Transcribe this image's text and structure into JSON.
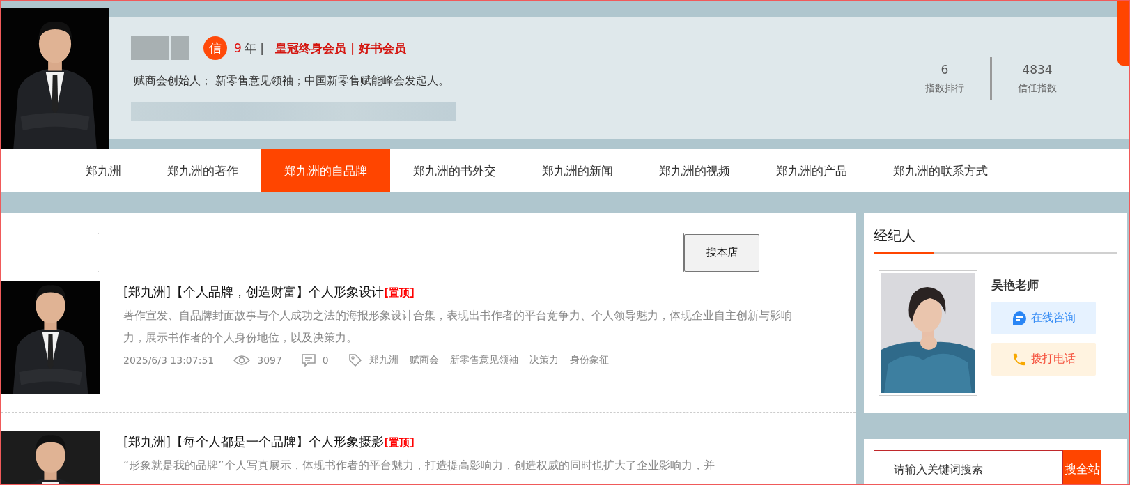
{
  "profile": {
    "badge": "信",
    "years": "9",
    "years_unit": "年 |",
    "membership": "皇冠终身会员 | 好书会员",
    "bio": "赋商会创始人； 新零售意见领袖；中国新零售赋能峰会发起人。",
    "stats": [
      {
        "value": "6",
        "label": "指数排行"
      },
      {
        "value": "4834",
        "label": "信任指数"
      }
    ]
  },
  "nav": [
    {
      "label": "郑九洲",
      "selected": false
    },
    {
      "label": "郑九洲的著作",
      "selected": false
    },
    {
      "label": "郑九洲的自品牌",
      "selected": true
    },
    {
      "label": "郑九洲的书外交",
      "selected": false
    },
    {
      "label": "郑九洲的新闻",
      "selected": false
    },
    {
      "label": "郑九洲的视频",
      "selected": false
    },
    {
      "label": "郑九洲的产品",
      "selected": false
    },
    {
      "label": "郑九洲的联系方式",
      "selected": false
    }
  ],
  "store_search": {
    "button": "搜本店"
  },
  "articles": [
    {
      "title": "[郑九洲]【个人品牌，创造财富】个人形象设计",
      "pin": "[置顶]",
      "description": "著作宣发、自品牌封面故事与个人成功之法的海报形象设计合集，表现出书作者的平台竞争力、个人领导魅力，体现企业自主创新与影响力，展示书作者的个人身份地位，以及决策力。",
      "date": "2025/6/3 13:07:51",
      "views": "3097",
      "comments": "0",
      "tags": [
        "郑九洲",
        "赋商会",
        "新零售意见领袖",
        "决策力",
        "身份象征"
      ]
    },
    {
      "title": "[郑九洲]【每个人都是一个品牌】个人形象摄影",
      "pin": "[置顶]",
      "description": "“形象就是我的品牌”个人写真展示，体现书作者的平台魅力，打造提高影响力，创造权威的同时也扩大了企业影响力，并"
    }
  ],
  "agent": {
    "heading": "经纪人",
    "name": "吴艳老师",
    "buttons": [
      {
        "kind": "chat",
        "label": "在线咨询"
      },
      {
        "kind": "phone",
        "label": "拨打电话"
      }
    ]
  },
  "site_search": {
    "placeholder": "请输入关键词搜索",
    "button": "搜全站"
  }
}
